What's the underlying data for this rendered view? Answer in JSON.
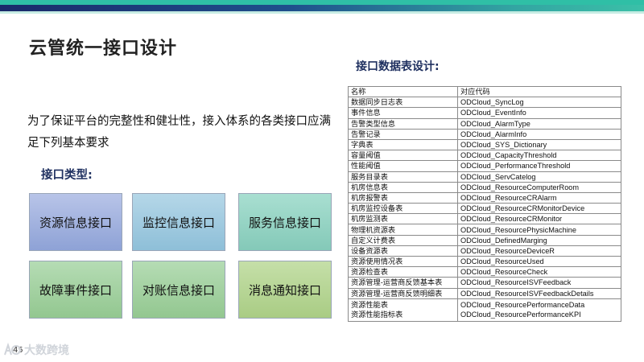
{
  "slide": {
    "title": "云管统一接口设计",
    "intro": "为了保证平台的完整性和健壮性，接入体系的各类接口应满足下列基本要求",
    "interface_types_heading": "接口类型:",
    "page_number": "45"
  },
  "tiles": [
    {
      "label": "资源信息接口",
      "color": "#9fb0de"
    },
    {
      "label": "监控信息接口",
      "color": "#a2cbe0"
    },
    {
      "label": "服务信息接口",
      "color": "#97d4c4"
    },
    {
      "label": "故障事件接口",
      "color": "#a4d2a2"
    },
    {
      "label": "对账信息接口",
      "color": "#a4d2a2"
    },
    {
      "label": "消息通知接口",
      "color": "#b7d696"
    }
  ],
  "table": {
    "heading": "接口数据表设计:",
    "columns": [
      "名称",
      "对应代码"
    ],
    "rows": [
      [
        "数据同步日志表",
        "ODCloud_SyncLog"
      ],
      [
        "事件信息",
        "ODCloud_EventInfo"
      ],
      [
        "告警类型信息",
        "ODCloud_AlarmType"
      ],
      [
        "告警记录",
        "ODCloud_AlarmInfo"
      ],
      [
        "字典表",
        "ODCloud_SYS_Dictionary"
      ],
      [
        "容量阈值",
        "ODCloud_CapacityThreshold"
      ],
      [
        "性能阈值",
        "ODCloud_PerformanceThreshold"
      ],
      [
        "服务目录表",
        "ODCloud_ServCatelog"
      ],
      [
        "机房信息表",
        "ODCloud_ResourceComputerRoom"
      ],
      [
        "机房报警表",
        "ODCloud_ResourceCRAlarm"
      ],
      [
        "机房监控设备表",
        "ODCloud_ResourceCRMonitorDevice"
      ],
      [
        "机房监测表",
        "ODCloud_ResourceCRMonitor"
      ],
      [
        "物理机资源表",
        "ODCloud_ResourcePhysicMachine"
      ],
      [
        "自定义计费表",
        "ODCloud_DefinedMarging"
      ],
      [
        "设备资源表",
        "ODCloud_ResourceDeviceR"
      ],
      [
        "资源使用情况表",
        "ODCloud_ResourceUsed"
      ],
      [
        "资源检查表",
        "ODCloud_ResourceCheck"
      ],
      [
        "资源管理-运营商反馈基本表",
        "ODCloud_ResourceISVFeedback"
      ],
      [
        "资源管理-运营商反馈明细表",
        "ODCloud_ResourceISVFeedbackDetails"
      ]
    ],
    "last_row": {
      "names": [
        "资源性能表",
        "资源性能指标表"
      ],
      "codes": [
        "ODCloud_ResourcePerformanceData",
        "ODCloud_ResourcePerformanceKPI"
      ]
    }
  },
  "watermark": {
    "text": "大数跨境",
    "icon": "logo-icon"
  }
}
